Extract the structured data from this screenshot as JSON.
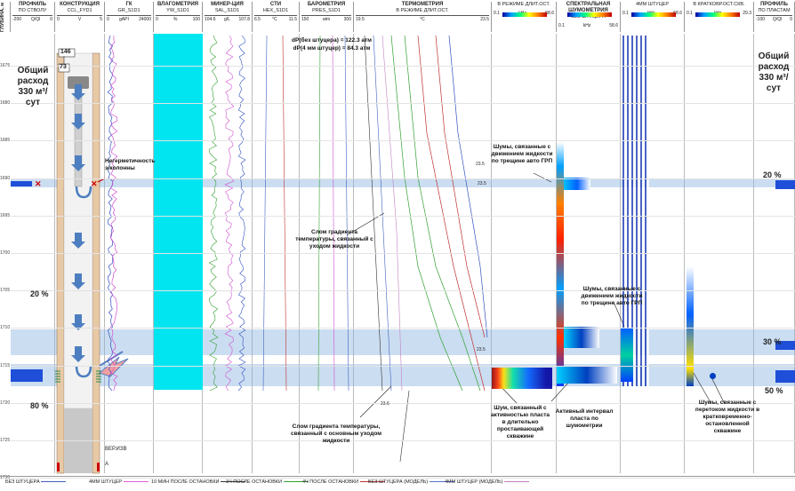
{
  "depth_axis": {
    "title": "ГЛУБИНА, м",
    "ticks": [
      "1675",
      "1680",
      "1685",
      "1690",
      "1695",
      "1700",
      "1705",
      "1710",
      "1715",
      "1720",
      "1725",
      "1730"
    ]
  },
  "tracks": [
    {
      "id": "profile-left",
      "title": "ПРОФИЛЬ",
      "subtitle": "ПО СТВОЛУ",
      "curve": "Q/Ql",
      "unit": "м³/сут",
      "min": "-200",
      "max": "0"
    },
    {
      "id": "construction",
      "title": "КОНСТРУКЦИЯ",
      "subtitle": "CCL_FYD1",
      "curve": "V",
      "unit": "",
      "min": "0",
      "max": "5"
    },
    {
      "id": "gk",
      "title": "ГК",
      "subtitle": "GR_S1D1",
      "curve": "gAPI",
      "unit": "",
      "min": "0",
      "max": "24000"
    },
    {
      "id": "moisture",
      "title": "ВЛАГОМЕТРИЯ",
      "subtitle": "YW_S1D1",
      "curve": "%",
      "unit": "",
      "min": "0",
      "max": "100"
    },
    {
      "id": "mineral",
      "title": "МИНЕР-ЦИЯ",
      "subtitle": "SAL_S1D1",
      "curve": "g/L",
      "unit": "",
      "min": "104.6",
      "max": "107.8"
    },
    {
      "id": "sti",
      "title": "СТИ",
      "subtitle": "HEX_S1D1",
      "curve": "°C",
      "unit": "",
      "min": "6.5",
      "max": "11.5"
    },
    {
      "id": "baro",
      "title": "БАРОМЕТРИЯ",
      "subtitle": "PRES_S1D1",
      "curve": "atm",
      "unit": "",
      "min": "150",
      "max": "300"
    },
    {
      "id": "thermo",
      "title": "ТЕРМОМЕТРИЯ",
      "subtitle": "В РЕЖИМЕ ДЛИТ.ОСТ.",
      "curve": "°C",
      "unit": "",
      "min": "19.5",
      "max": "23.5"
    },
    {
      "id": "spec1",
      "title": "",
      "subtitle": "В РЕЖИМЕ ДЛИТ.ОСТ.",
      "curve": "kHz",
      "unit": "dB SPL",
      "min": "0.1",
      "max": "58.6",
      "db_min": "64",
      "db_max": "95"
    },
    {
      "id": "spec2",
      "title": "СПЕКТРАЛЬНАЯ ШУМОМЕТРИЯ",
      "subtitle": "БЕЗ ШТУЦЕРА",
      "curve": "kHz",
      "unit": "dB SPL",
      "min": "0.1",
      "max": "58.6",
      "db_min": "67",
      "db_max": "105"
    },
    {
      "id": "spec3",
      "title": "",
      "subtitle": "4ММ ШТУЦЕР",
      "curve": "kHz",
      "unit": "dB SPL",
      "min": "0.1",
      "max": "58.6",
      "db_min": "69",
      "db_max": "105"
    },
    {
      "id": "spec4",
      "title": "",
      "subtitle": "В КРАТКОВР.ОСТ.СКВ.",
      "curve": "kHz",
      "unit": "dB SPL",
      "min": "0.1",
      "max": "29.3",
      "db_min": "65",
      "db_max": "95"
    },
    {
      "id": "profile-right",
      "title": "ПРОФИЛЬ",
      "subtitle": "ПО ПЛАСТАМ",
      "curve": "Q/Ql",
      "unit": "м³/сут",
      "min": "-100",
      "max": "0"
    }
  ],
  "labels": {
    "total_left": "Общий расход 330 м³/сут",
    "total_right": "Общий расход 330 м³/сут",
    "pct_left_20": "20 %",
    "pct_left_80": "80 %",
    "pct_right_20": "20 %",
    "pct_right_30": "30 %",
    "pct_right_50": "50 %",
    "depth_146": "146",
    "depth_73": "73",
    "leak": "Негерметичность э/колонны",
    "ver_izv": "ВЕР.ИЗВ",
    "dp1": "dP(без штуцера) = 122.3 атм",
    "dp2": "dP(4 мм штуцер) = 84.3 атм",
    "grad1": "Слом градиента температуры, связанный с уходом жидкости",
    "grad2": "Слом градиента температуры, связанный с основным уходом жидкости",
    "noise_top": "Шумы, связанные с движением жидкости по трещине авто ГРП",
    "noise_mid": "Шумы, связанные с движением жидкости по трещине авто ГРП",
    "noise_layer": "Шум, связанный с активностью пласта в длительно простаивающей скважине",
    "active": "Активный интервал пласта по шумометрии",
    "noise_short": "Шумы, связанные с перетоком жидкости в кратковременно-остановленной скважине",
    "t_23_5a": "23.5",
    "t_23_5b": "23.5",
    "t_23_5c": "23.5",
    "t_23_6": "23.6"
  },
  "legend": [
    {
      "label": "БЕЗ ШТУЦЕРА",
      "color": "#4060c0"
    },
    {
      "label": "4ММ ШТУЦЕР",
      "color": "#e060e0"
    },
    {
      "label": "10 МИН ПОСЛЕ ОСТАНОВКИ",
      "color": "#333333"
    },
    {
      "label": "1Ч ПОСЛЕ ОСТАНОВКИ",
      "color": "#30a030"
    },
    {
      "label": "4Ч ПОСЛЕ ОСТАНОВКИ",
      "color": "#c03030"
    },
    {
      "label": "БЕЗ ШТУЦЕРА (МОДЕЛЬ)",
      "color": "#5070d0"
    },
    {
      "label": "4ММ ШТУЦЕР (МОДЕЛЬ)",
      "color": "#c080c0"
    }
  ],
  "colors": {
    "band": "#8cb4e1",
    "moisture": "#00e5f0",
    "profile": "#1f4fd8",
    "casing": "#d9b38c"
  }
}
